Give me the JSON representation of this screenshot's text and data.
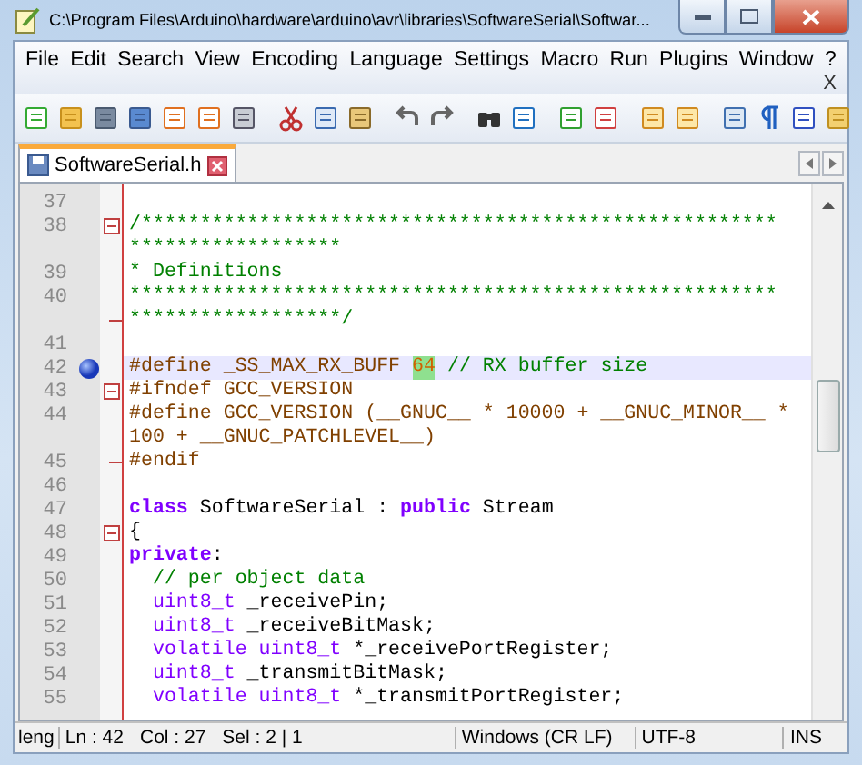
{
  "window": {
    "title": "C:\\Program Files\\Arduino\\hardware\\arduino\\avr\\libraries\\SoftwareSerial\\Softwar..."
  },
  "menu": [
    "File",
    "Edit",
    "Search",
    "View",
    "Encoding",
    "Language",
    "Settings",
    "Macro",
    "Run",
    "Plugins",
    "Window",
    "?"
  ],
  "menu_close": "X",
  "tabs": [
    {
      "label": "SoftwareSerial.h",
      "selected": true
    }
  ],
  "editor": {
    "lines": [
      {
        "number": "37",
        "current": false,
        "bookmarked": false,
        "fold_start": false,
        "fold_end": false
      },
      {
        "number": "38",
        "current": false,
        "bookmarked": false,
        "fold_start": true,
        "fold_end": false,
        "rows": [
          [
            {
              "kind": "comment",
              "t": "/******************************************************"
            }
          ],
          [
            {
              "kind": "comment",
              "t": "******************"
            }
          ]
        ]
      },
      {
        "number": "39",
        "current": false,
        "bookmarked": false,
        "fold_start": false,
        "fold_end": false,
        "rows": [
          [
            {
              "kind": "comment",
              "t": "* Definitions"
            }
          ]
        ]
      },
      {
        "number": "40",
        "current": false,
        "bookmarked": false,
        "fold_start": false,
        "fold_end": true,
        "rows": [
          [
            {
              "kind": "comment",
              "t": "*******************************************************"
            }
          ],
          [
            {
              "kind": "comment",
              "t": "******************/"
            }
          ]
        ]
      },
      {
        "number": "41",
        "current": false,
        "bookmarked": false,
        "fold_start": false,
        "fold_end": false
      },
      {
        "number": "42",
        "current": true,
        "bookmarked": true,
        "fold_start": false,
        "fold_end": false,
        "rows": [
          [
            {
              "kind": "preproc",
              "t": "#define _SS_MAX_RX_BUFF "
            },
            {
              "kind": "number",
              "t": "64"
            },
            {
              "kind": "comment",
              "t": " // RX buffer size"
            }
          ]
        ]
      },
      {
        "number": "43",
        "current": false,
        "bookmarked": false,
        "fold_start": true,
        "fold_end": false,
        "rows": [
          [
            {
              "kind": "preproc",
              "t": "#ifndef GCC_VERSION"
            }
          ]
        ]
      },
      {
        "number": "44",
        "current": false,
        "bookmarked": false,
        "fold_start": false,
        "fold_end": false,
        "rows": [
          [
            {
              "kind": "preproc",
              "t": "#define GCC_VERSION (__GNUC__ * 10000 + __GNUC_MINOR__ *"
            }
          ],
          [
            {
              "kind": "preproc",
              "t": "100 + __GNUC_PATCHLEVEL__)"
            }
          ]
        ]
      },
      {
        "number": "45",
        "current": false,
        "bookmarked": false,
        "fold_start": false,
        "fold_end": true,
        "rows": [
          [
            {
              "kind": "preproc",
              "t": "#endif"
            }
          ]
        ]
      },
      {
        "number": "46",
        "current": false,
        "bookmarked": false,
        "fold_start": false,
        "fold_end": false
      },
      {
        "number": "47",
        "current": false,
        "bookmarked": false,
        "fold_start": false,
        "fold_end": false,
        "rows": [
          [
            {
              "kind": "keyword",
              "t": "class"
            },
            {
              "kind": "plain",
              "t": " SoftwareSerial : "
            },
            {
              "kind": "keyword",
              "t": "public"
            },
            {
              "kind": "plain",
              "t": " Stream"
            }
          ]
        ]
      },
      {
        "number": "48",
        "current": false,
        "bookmarked": false,
        "fold_start": true,
        "fold_end": false,
        "rows": [
          [
            {
              "kind": "plain",
              "t": "{"
            }
          ]
        ]
      },
      {
        "number": "49",
        "current": false,
        "bookmarked": false,
        "fold_start": false,
        "fold_end": false,
        "rows": [
          [
            {
              "kind": "keyword",
              "t": "private"
            },
            {
              "kind": "plain",
              "t": ":"
            }
          ]
        ]
      },
      {
        "number": "50",
        "current": false,
        "bookmarked": false,
        "fold_start": false,
        "fold_end": false,
        "rows": [
          [
            {
              "kind": "comment",
              "t": "  // per object data"
            }
          ]
        ]
      },
      {
        "number": "51",
        "current": false,
        "bookmarked": false,
        "fold_start": false,
        "fold_end": false,
        "rows": [
          [
            {
              "kind": "type",
              "t": "  uint8_t"
            },
            {
              "kind": "plain",
              "t": " _receivePin;"
            }
          ]
        ]
      },
      {
        "number": "52",
        "current": false,
        "bookmarked": false,
        "fold_start": false,
        "fold_end": false,
        "rows": [
          [
            {
              "kind": "type",
              "t": "  uint8_t"
            },
            {
              "kind": "plain",
              "t": " _receiveBitMask;"
            }
          ]
        ]
      },
      {
        "number": "53",
        "current": false,
        "bookmarked": false,
        "fold_start": false,
        "fold_end": false,
        "rows": [
          [
            {
              "kind": "type",
              "t": "  volatile uint8_t"
            },
            {
              "kind": "plain",
              "t": " *_receivePortRegister;"
            }
          ]
        ]
      },
      {
        "number": "54",
        "current": false,
        "bookmarked": false,
        "fold_start": false,
        "fold_end": false,
        "rows": [
          [
            {
              "kind": "type",
              "t": "  uint8_t"
            },
            {
              "kind": "plain",
              "t": " _transmitBitMask;"
            }
          ]
        ]
      },
      {
        "number": "55",
        "current": false,
        "bookmarked": false,
        "fold_start": false,
        "fold_end": false,
        "rows": [
          [
            {
              "kind": "type",
              "t": "  volatile uint8_t"
            },
            {
              "kind": "plain",
              "t": " *_transmitPortRegister;"
            }
          ]
        ]
      }
    ]
  },
  "status_bar": {
    "cut_label": "leng",
    "line": "Ln : 42",
    "column": "Col : 27",
    "selection": "Sel : 2 | 1",
    "eol": "Windows (CR LF)",
    "encoding": "UTF-8",
    "mode": "INS"
  }
}
